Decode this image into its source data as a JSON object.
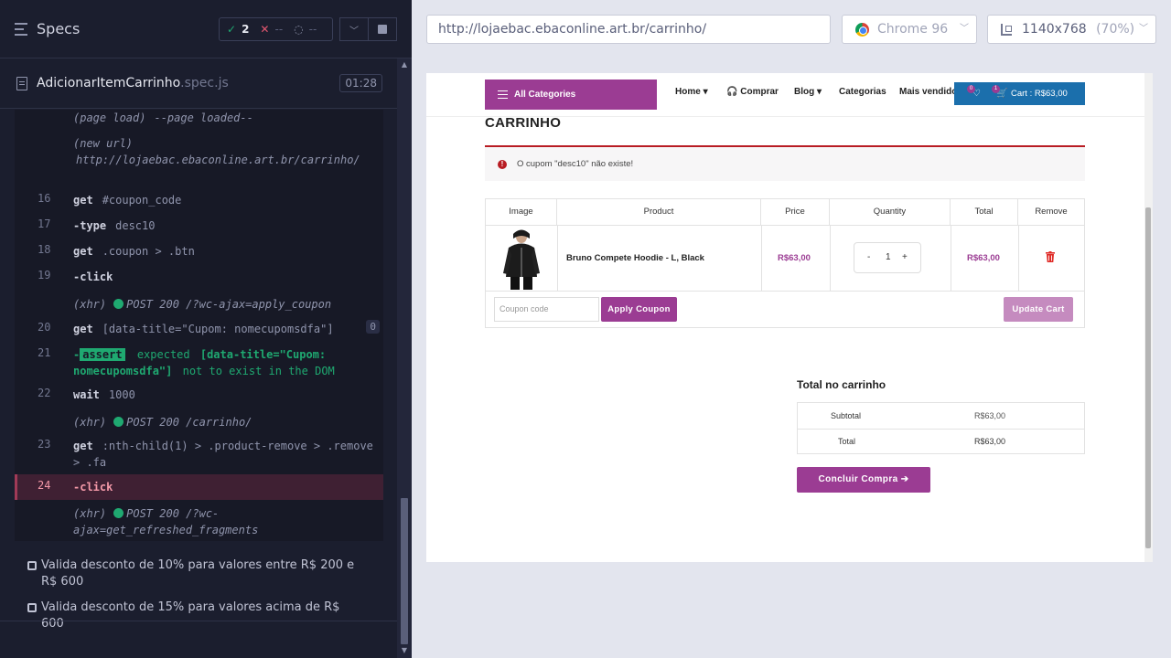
{
  "runner": {
    "specs_title": "Specs",
    "stats": {
      "passed": "2",
      "failed": "--",
      "pending": "--"
    },
    "spec_file": {
      "name": "AdicionarItemCarrinho",
      "ext": ".spec.js",
      "duration": "01:28"
    },
    "commands": [
      {
        "num": "",
        "name": "(page load)",
        "arg": "--page loaded--"
      },
      {
        "num": "",
        "name": "(new url)",
        "arg": "http://lojaebac.ebaconline.art.br/carrinho/"
      },
      {
        "num": "16",
        "name": "get",
        "arg": "#coupon_code"
      },
      {
        "num": "17",
        "name": "-type",
        "arg": "desc10"
      },
      {
        "num": "18",
        "name": "get",
        "arg": ".coupon > .btn"
      },
      {
        "num": "19",
        "name": "-click",
        "arg": ""
      },
      {
        "num": "",
        "name": "(xhr)",
        "arg": "POST 200 /?wc-ajax=apply_coupon"
      },
      {
        "num": "20",
        "name": "get",
        "arg": "[data-title=\"Cupom: nomecupomsdfa\"]",
        "badge": "0"
      },
      {
        "num": "21",
        "name": "-",
        "assert_label": "assert",
        "expected_label": "expected",
        "expected_sel": "[data-title=\"Cupom: nomecupomsdfa\"]",
        "tail": "not to exist in the DOM"
      },
      {
        "num": "22",
        "name": "wait",
        "arg": "1000"
      },
      {
        "num": "",
        "name": "(xhr)",
        "arg": "POST 200 /carrinho/"
      },
      {
        "num": "23",
        "name": "get",
        "arg": ":nth-child(1) > .product-remove > .remove > .fa"
      },
      {
        "num": "24",
        "name": "-click",
        "arg": ""
      },
      {
        "num": "",
        "name": "(xhr)",
        "arg": "POST 200 /?wc-ajax=get_refreshed_fragments"
      }
    ],
    "tests": [
      "Valida desconto de 10% para valores entre R$ 200 e R$ 600",
      "Valida desconto de 15% para valores acima de R$ 600"
    ]
  },
  "browser": {
    "url": "http://lojaebac.ebaconline.art.br/carrinho/",
    "browser_name": "Chrome 96",
    "viewport": "1140x768",
    "zoom": "(70%)"
  },
  "site": {
    "all_categories": "All Categories",
    "menu": [
      "Home",
      "Comprar",
      "Blog",
      "Categorias",
      "Mais vendidos"
    ],
    "wishlist_count": "0",
    "cart_count": "1",
    "cart_label": "Cart : R$63,00",
    "page_title": "CARRINHO",
    "notice": "O cupom \"desc10\" não existe!",
    "table_headers": [
      "Image",
      "Product",
      "Price",
      "Quantity",
      "Total",
      "Remove"
    ],
    "item": {
      "name": "Bruno Compete Hoodie - L, Black",
      "price": "R$63,00",
      "qty": "1",
      "total": "R$63,00"
    },
    "coupon_placeholder": "Coupon code",
    "apply_coupon": "Apply Coupon",
    "update_cart": "Update Cart",
    "totals_title": "Total no carrinho",
    "subtotal_label": "Subtotal",
    "subtotal_value": "R$63,00",
    "total_label": "Total",
    "total_value": "R$63,00",
    "checkout": "Concluir Compra ➔"
  },
  "colors": {
    "accent": "#9b3c93",
    "cart_blue": "#1b6fac",
    "pass_green": "#1fa971",
    "fail_red": "#e45770"
  }
}
